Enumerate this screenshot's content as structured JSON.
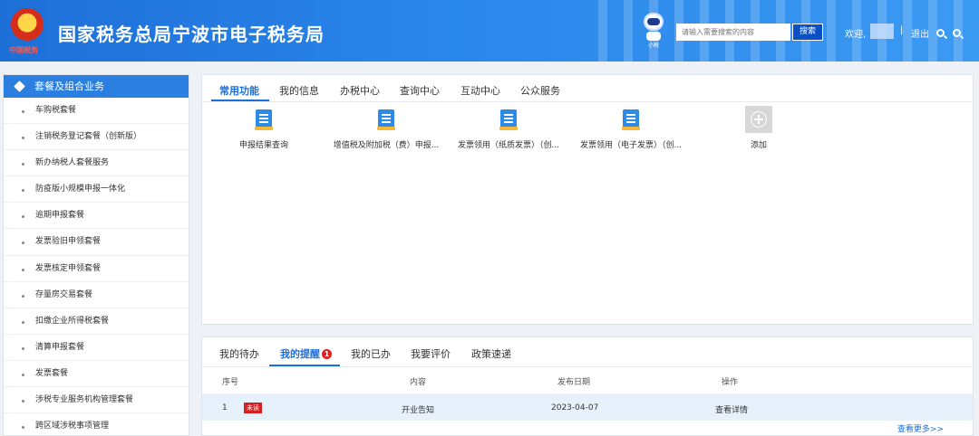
{
  "header": {
    "site_title": "国家税务总局宁波市电子税务局",
    "emblem_text": "中国税务",
    "robot_label": "小税",
    "search_placeholder": "请输入需要搜索的内容",
    "search_button": "搜索",
    "welcome": "欢迎,",
    "separator": "|",
    "logout": "退出"
  },
  "sidebar": {
    "title": "套餐及组合业务",
    "items": [
      "车购税套餐",
      "注销税务登记套餐（创新版）",
      "新办纳税人套餐服务",
      "防疫版小规模申报一体化",
      "逾期申报套餐",
      "发票验旧申领套餐",
      "发票核定申领套餐",
      "存量房交易套餐",
      "扣缴企业所得税套餐",
      "清算申报套餐",
      "发票套餐",
      "涉税专业服务机构管理套餐",
      "跨区域涉税事项管理"
    ]
  },
  "top_tabs": [
    "常用功能",
    "我的信息",
    "办税中心",
    "查询中心",
    "互动中心",
    "公众服务"
  ],
  "functions": [
    {
      "label": "申报结果查询",
      "icon": "document-icon"
    },
    {
      "label": "增值税及附加税（费）申报...",
      "icon": "document-icon"
    },
    {
      "label": "发票领用（纸质发票）（创...",
      "icon": "document-icon"
    },
    {
      "label": "发票领用（电子发票）（创...",
      "icon": "document-icon"
    },
    {
      "label": "添加",
      "icon": "add-icon"
    }
  ],
  "bottom_tabs": {
    "items": [
      "我的待办",
      "我的提醒",
      "我的已办",
      "我要评价",
      "政策速递"
    ],
    "reminder_badge": "1"
  },
  "table": {
    "headers": [
      "序号",
      "内容",
      "发布日期",
      "操作"
    ],
    "rows": [
      {
        "index": "1",
        "status": "未读",
        "content": "开业告知",
        "date": "2023-04-07",
        "action": "查看详情"
      }
    ],
    "more": "查看更多>>"
  },
  "colors": {
    "brand_blue": "#1d6fd8",
    "header_gradient_end": "#3b9af2",
    "alert_red": "#e02020",
    "icon_tray": "#f3b73a"
  }
}
